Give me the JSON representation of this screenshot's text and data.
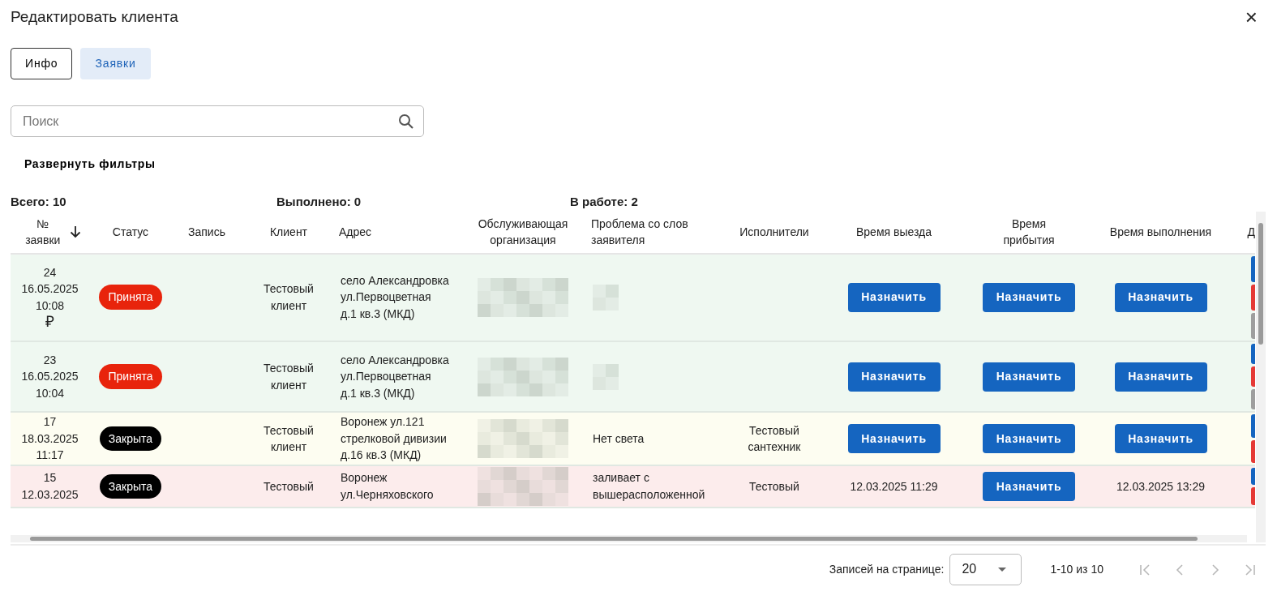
{
  "dialog": {
    "title": "Редактировать клиента",
    "close": "×"
  },
  "tabs": [
    {
      "label": "Инфо",
      "selected": false,
      "focused": true
    },
    {
      "label": "Заявки",
      "selected": true,
      "focused": false
    }
  ],
  "search": {
    "placeholder": "Поиск"
  },
  "filters_toggle": "Развернуть фильтры",
  "summary": [
    {
      "label": "Всего: 10"
    },
    {
      "label": "Выполнено: 0"
    },
    {
      "label": "В работе: 2"
    }
  ],
  "table": {
    "columns": [
      {
        "label": "№ заявки",
        "sorted": true
      },
      {
        "label": "Статус",
        "sorted": false
      },
      {
        "label": "Запись",
        "sorted": false
      },
      {
        "label": "Клиент",
        "sorted": false
      },
      {
        "label": "Адрес",
        "sorted": false
      },
      {
        "label": "Обслуживающая организация",
        "sorted": false
      },
      {
        "label": "Проблема со слов заявителя",
        "sorted": false
      },
      {
        "label": "Исполнители",
        "sorted": false
      },
      {
        "label": "Время выезда",
        "sorted": false
      },
      {
        "label": "Время прибытия",
        "sorted": false
      },
      {
        "label": "Время выполнения",
        "sorted": false
      },
      {
        "label": "Д",
        "sorted": false
      }
    ],
    "rows": [
      {
        "color": "#eff8f1",
        "number": "24",
        "date": "16.05.2025",
        "time": "10:08",
        "paid_mark": "₽",
        "status": {
          "label": "Принята",
          "color": "#e8240c"
        },
        "client": "Тестовый клиент",
        "address": "село Александровка ул.Первоцветная д.1 кв.3 (МКД)",
        "organization": {
          "kind": "blurred"
        },
        "problem": {
          "kind": "blurred"
        },
        "departure": {
          "kind": "button",
          "text": "Назначить"
        },
        "arrival": {
          "kind": "button",
          "text": "Назначить"
        },
        "completion": {
          "kind": "button",
          "text": "Назначить"
        },
        "actions": [
          {
            "color": "#1565c0"
          },
          {
            "color": "#e53935"
          },
          {
            "color": "#9e9e9e"
          }
        ]
      },
      {
        "color": "#eff8f1",
        "number": "23",
        "date": "16.05.2025",
        "time": "10:04",
        "status": {
          "label": "Принята",
          "color": "#e8240c"
        },
        "client": "Тестовый клиент",
        "address": "село Александровка ул.Первоцветная д.1 кв.3 (МКД)",
        "organization": {
          "kind": "blurred"
        },
        "problem": {
          "kind": "blurred"
        },
        "departure": {
          "kind": "button",
          "text": "Назначить"
        },
        "arrival": {
          "kind": "button",
          "text": "Назначить"
        },
        "completion": {
          "kind": "button",
          "text": "Назначить"
        },
        "actions": [
          {
            "color": "#1565c0"
          },
          {
            "color": "#e53935"
          },
          {
            "color": "#9e9e9e"
          }
        ]
      },
      {
        "color": "#fdfdf1",
        "number": "17",
        "date": "18.03.2025",
        "time": "11:17",
        "status": {
          "label": "Закрыта",
          "color": "#000000"
        },
        "client": "Тестовый клиент",
        "address": "Воронеж ул.121 стрелковой дивизии д.16 кв.3 (МКД)",
        "organization": {
          "kind": "blurred"
        },
        "problem": {
          "kind": "text",
          "text": "Нет света"
        },
        "executor": "Тестовый сантехник",
        "departure": {
          "kind": "button",
          "text": "Назначить"
        },
        "arrival": {
          "kind": "button",
          "text": "Назначить"
        },
        "completion": {
          "kind": "button",
          "text": "Назначить"
        },
        "actions": [
          {
            "color": "#1565c0"
          },
          {
            "color": "#e53935"
          }
        ]
      },
      {
        "color": "#fcecec",
        "number": "15",
        "date": "12.03.2025",
        "status": {
          "label": "Закрыта",
          "color": "#000000"
        },
        "client": "Тестовый",
        "address": "Воронеж ул.Черняховского",
        "organization": {
          "kind": "blurred"
        },
        "problem": {
          "kind": "text",
          "text": "заливает с вышерасположенной"
        },
        "executor": "Тестовый",
        "departure": {
          "kind": "time",
          "text": "12.03.2025 11:29"
        },
        "arrival": {
          "kind": "button",
          "text": "Назначить"
        },
        "completion": {
          "kind": "time",
          "text": "12.03.2025 13:29"
        },
        "actions": [
          {
            "color": "#1565c0"
          },
          {
            "color": "#e53935"
          }
        ]
      }
    ]
  },
  "pagination": {
    "rows_label": "Записей на странице:",
    "rows_per_page": "20",
    "range": "1-10 из 10",
    "nav": [
      {
        "kind": "first",
        "disabled": true
      },
      {
        "kind": "prev",
        "disabled": true
      },
      {
        "kind": "next",
        "disabled": true
      },
      {
        "kind": "last",
        "disabled": true
      }
    ]
  }
}
